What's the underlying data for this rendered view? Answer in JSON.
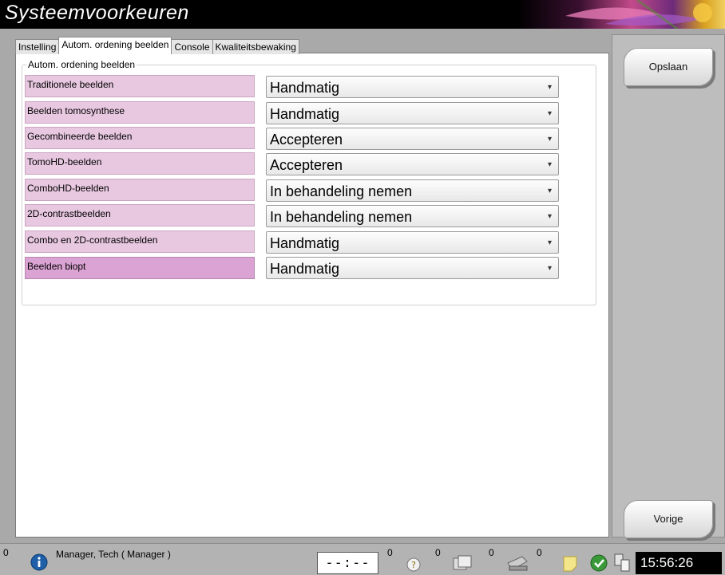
{
  "window": {
    "title": "Systeemvoorkeuren"
  },
  "tabs": [
    {
      "label": "Instelling"
    },
    {
      "label": "Autom. ordening beelden"
    },
    {
      "label": "Console"
    },
    {
      "label": "Kwaliteitsbewaking"
    }
  ],
  "active_tab": "Autom. ordening beelden",
  "group": {
    "label": "Autom. ordening beelden",
    "rows": [
      {
        "label": "Traditionele beelden",
        "value": "Handmatig"
      },
      {
        "label": "Beelden tomosynthese",
        "value": "Handmatig"
      },
      {
        "label": "Gecombineerde beelden",
        "value": "Accepteren"
      },
      {
        "label": "TomoHD-beelden",
        "value": "Accepteren"
      },
      {
        "label": "ComboHD-beelden",
        "value": "In behandeling nemen"
      },
      {
        "label": "2D-contrastbeelden",
        "value": "In behandeling nemen"
      },
      {
        "label": "Combo en 2D-contrastbeelden",
        "value": "Handmatig"
      },
      {
        "label": "Beelden biopt",
        "value": "Handmatig"
      }
    ]
  },
  "buttons": {
    "save": "Opslaan",
    "back": "Vorige"
  },
  "statusbar": {
    "info_count": "0",
    "user": "Manager, Tech ( Manager )",
    "timer": "--:--",
    "counts": [
      "0",
      "0",
      "0",
      "0"
    ],
    "time": "15:56:26"
  },
  "colors": {
    "row_label": "#e8c8e0",
    "row_label_selected": "#dba3d3",
    "panel_bg": "#a9a9a9",
    "statusbar_bg": "#b3b3b3"
  }
}
